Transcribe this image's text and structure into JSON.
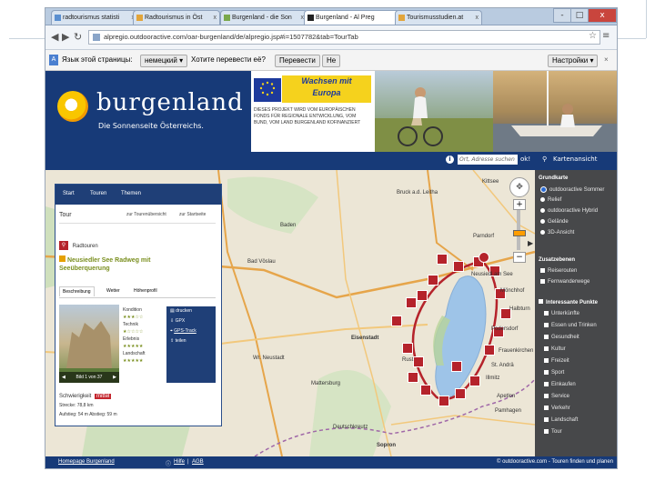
{
  "browser": {
    "tabs": [
      {
        "label": "radtourismus statisti"
      },
      {
        "label": "Radtourismus in Öst"
      },
      {
        "label": "Burgenland - die Son"
      },
      {
        "label": "Burgenland - Al Preg"
      },
      {
        "label": "Tourismusstudien.at"
      }
    ],
    "window_buttons": [
      "-",
      "□",
      "x"
    ],
    "url": "alpregio.outdooractive.com/oar-burgenland/de/alpregio.jsp#i=1507782&tab=TourTab"
  },
  "translate_bar": {
    "language_text": "Язык этой страницы:",
    "language_select": "немецкий",
    "question": "Хотите перевести её?",
    "translate_button": "Перевести",
    "no_button": "Не",
    "settings_button": "Настройки"
  },
  "banner": {
    "brand": "burgenland",
    "tagline": "Die Sonnenseite Österreichs.",
    "wachsen_line1": "Wachsen mit",
    "wachsen_line2": "Europa",
    "eu_text": "DIESES PROJEKT WIRD VOM EUROPÄISCHEN FONDS FÜR REGIONALE ENTWICKLUNG, VOM BUND, VOM LAND BURGENLAND KOFINANZIERT"
  },
  "strip": {
    "search_placeholder": "Ort, Adresse suchen",
    "ok": "ok!",
    "map_link": "Kartenansicht"
  },
  "panel": {
    "nav": [
      "Start",
      "Touren",
      "Themen"
    ],
    "tour_label": "Tour",
    "overview_link": "zur Tourenübersicht",
    "start_link": "zur Startseite",
    "category": "Radtouren",
    "tour_title_line1": "Neusiedler See Radweg mit",
    "tour_title_line2": "Seeüberquerung",
    "tabs": [
      "Beschreibung",
      "Wetter",
      "Höhenprofil"
    ],
    "ratings": [
      "Kondition",
      "Technik",
      "Erlebnis",
      "Landschaft"
    ],
    "actions": [
      "drucken",
      "GPX",
      "GPS-Track",
      "teilen"
    ],
    "image_nav": "Bild 1 von 37",
    "difficulty_label": "Schwierigkeit",
    "difficulty_value": "mittel",
    "distance": "Strecke: 78,8 km",
    "ascent": "Aufstieg: 54 m  Abstieg: 59 m"
  },
  "map_labels": [
    "Baden",
    "Bad Vöslau",
    "Wr. Neustadt",
    "Eisenstadt",
    "Rust",
    "Mattersburg",
    "Neusiedl am See",
    "Podersdorf",
    "Illmitz",
    "Apetlon",
    "Bruck a.d. Leitha",
    "Kittsee",
    "Parndorf",
    "Mönchhof",
    "Halbturn",
    "Frauenkirchen",
    "St. Andrä",
    "Pamhagen",
    "Sopron",
    "Deutschkreutz"
  ],
  "side": {
    "base_map_title": "Grundkarte",
    "base_maps": [
      "outdooractive Sommer",
      "Relief",
      "outdooractive Hybrid",
      "Gelände",
      "3D-Ansicht"
    ],
    "extras_title": "Zusatzebenen",
    "extras": [
      "Reiserouten",
      "Fernwanderwege"
    ],
    "poi_title": "Interessante Punkte",
    "pois": [
      "Unterkünfte",
      "Essen und Trinken",
      "Gesundheit",
      "Kultur",
      "Freizeit",
      "Sport",
      "Einkaufen",
      "Service",
      "Verkehr",
      "Landschaft",
      "Tour"
    ]
  },
  "footer": {
    "homepage": "Homepage Burgenland",
    "help": "Hilfe",
    "imprint": "AGB",
    "copyright": "© outdooractive.com - Touren finden und planen"
  },
  "colors": {
    "navy": "#173a78",
    "panel_nav": "#1f3f77",
    "marker_red": "#b5232b",
    "lake_blue": "#9ec4e8"
  }
}
